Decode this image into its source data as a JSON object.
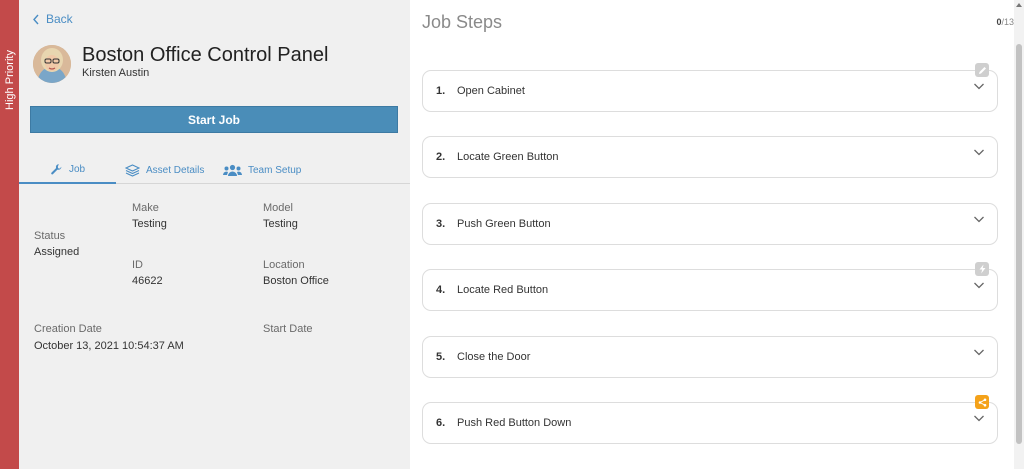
{
  "priority": {
    "label": "High Priority",
    "color": "#c34a4a"
  },
  "nav": {
    "back_label": "Back"
  },
  "job": {
    "title": "Boston Office Control Panel",
    "assignee": "Kirsten Austin",
    "start_button": "Start Job"
  },
  "tabs": [
    {
      "label": "Job",
      "icon": "wrench-icon",
      "active": true
    },
    {
      "label": "Asset Details",
      "icon": "layers-icon",
      "active": false
    },
    {
      "label": "Team Setup",
      "icon": "team-icon",
      "active": false
    }
  ],
  "details": {
    "make_label": "Make",
    "make_value": "Testing",
    "model_label": "Model",
    "model_value": "Testing",
    "status_label": "Status",
    "status_value": "Assigned",
    "id_label": "ID",
    "id_value": "46622",
    "location_label": "Location",
    "location_value": "Boston Office",
    "creation_label": "Creation Date",
    "creation_value": "October 13, 2021 10:54:37 AM",
    "start_label": "Start Date"
  },
  "steps_panel": {
    "title": "Job Steps",
    "completed": "0",
    "total": "/13",
    "steps": [
      {
        "num": "1.",
        "label": "Open Cabinet",
        "badge": "pencil-icon",
        "badge_color": "#cfcfcf"
      },
      {
        "num": "2.",
        "label": "Locate Green Button"
      },
      {
        "num": "3.",
        "label": "Push Green Button"
      },
      {
        "num": "4.",
        "label": "Locate Red Button",
        "badge": "lightning-icon",
        "badge_color": "#cfcfcf"
      },
      {
        "num": "5.",
        "label": "Close the Door"
      },
      {
        "num": "6.",
        "label": "Push Red Button Down",
        "badge": "share-icon",
        "badge_color": "#f4a21a"
      }
    ]
  },
  "colors": {
    "accent": "#4a8dc4",
    "button": "#4a8db8"
  }
}
